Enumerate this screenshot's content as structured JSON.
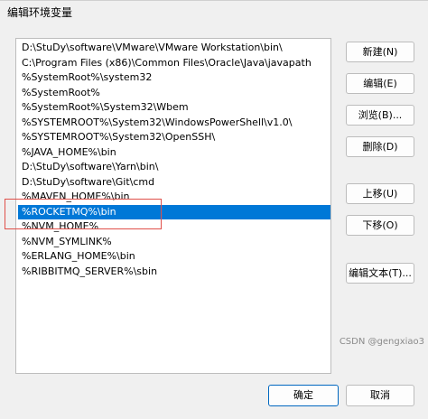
{
  "window": {
    "title": "编辑环境变量"
  },
  "list": {
    "items": [
      {
        "text": "D:\\StuDy\\software\\VMware\\VMware Workstation\\bin\\"
      },
      {
        "text": "C:\\Program Files (x86)\\Common Files\\Oracle\\Java\\javapath"
      },
      {
        "text": "%SystemRoot%\\system32"
      },
      {
        "text": "%SystemRoot%"
      },
      {
        "text": "%SystemRoot%\\System32\\Wbem"
      },
      {
        "text": "%SYSTEMROOT%\\System32\\WindowsPowerShell\\v1.0\\"
      },
      {
        "text": "%SYSTEMROOT%\\System32\\OpenSSH\\"
      },
      {
        "text": "%JAVA_HOME%\\bin"
      },
      {
        "text": "D:\\StuDy\\software\\Yarn\\bin\\"
      },
      {
        "text": "D:\\StuDy\\software\\Git\\cmd"
      },
      {
        "text": "%MAVEN_HOME%\\bin"
      },
      {
        "text": "%ROCKETMQ%\\bin"
      },
      {
        "text": "%NVM_HOME%"
      },
      {
        "text": "%NVM_SYMLINK%"
      },
      {
        "text": "%ERLANG_HOME%\\bin"
      },
      {
        "text": "%RIBBITMQ_SERVER%\\sbin"
      }
    ],
    "selected_index": 11
  },
  "buttons": {
    "new": "新建(N)",
    "edit": "编辑(E)",
    "browse": "浏览(B)...",
    "delete": "删除(D)",
    "move_up": "上移(U)",
    "move_down": "下移(O)",
    "edit_text": "编辑文本(T)...",
    "ok": "确定",
    "cancel": "取消"
  },
  "watermark": "CSDN @gengxiao3",
  "colors": {
    "selection": "#0078d7",
    "annotation_box": "#e0504a"
  }
}
